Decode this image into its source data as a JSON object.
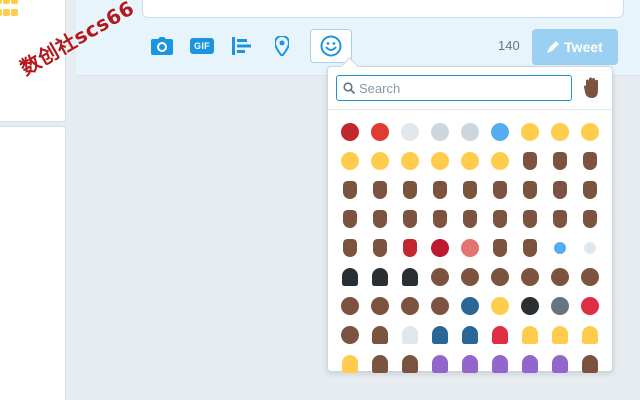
{
  "composer": {
    "char_count": "140",
    "tweet_label": "Tweet",
    "tools": [
      {
        "name": "photo-button",
        "icon": "camera-icon"
      },
      {
        "name": "gif-button",
        "icon": "gif-icon",
        "label": "GIF"
      },
      {
        "name": "poll-button",
        "icon": "poll-icon"
      },
      {
        "name": "location-button",
        "icon": "location-pin-icon"
      },
      {
        "name": "emoji-button",
        "icon": "smiley-icon"
      }
    ]
  },
  "watermark": "数创社scs66",
  "picker": {
    "search_placeholder": "Search",
    "skin_tone_icon": "raised-hand-icon",
    "emojis": [
      {
        "icon": "ogre-icon",
        "color": "#c1272d",
        "type": "face"
      },
      {
        "icon": "goblin-icon",
        "color": "#e03c31",
        "type": "face"
      },
      {
        "icon": "skull-icon",
        "color": "#e1e8ed",
        "type": "face"
      },
      {
        "icon": "ghost-icon",
        "color": "#ccd6dd",
        "type": "face"
      },
      {
        "icon": "alien-icon",
        "color": "#ccd6dd",
        "type": "face"
      },
      {
        "icon": "space-invader-icon",
        "color": "#55acee",
        "type": "face"
      },
      {
        "icon": "cat-smile-icon",
        "color": "#ffcc4d",
        "type": "face"
      },
      {
        "icon": "cat-grin-icon",
        "color": "#ffcc4d",
        "type": "face"
      },
      {
        "icon": "cat-joy-icon",
        "color": "#ffcc4d",
        "type": "face"
      },
      {
        "icon": "cat-heart-eyes-icon",
        "color": "#ffcc4d",
        "type": "face"
      },
      {
        "icon": "cat-smirk-icon",
        "color": "#ffcc4d",
        "type": "face"
      },
      {
        "icon": "cat-kiss-icon",
        "color": "#ffcc4d",
        "type": "face"
      },
      {
        "icon": "cat-scream-icon",
        "color": "#ffcc4d",
        "type": "face"
      },
      {
        "icon": "cat-cry-icon",
        "color": "#ffcc4d",
        "type": "face"
      },
      {
        "icon": "cat-pout-icon",
        "color": "#ffcc4d",
        "type": "face"
      },
      {
        "icon": "raised-hands-icon",
        "color": "#7c533e",
        "type": "hand"
      },
      {
        "icon": "clap-icon",
        "color": "#7c533e",
        "type": "hand"
      },
      {
        "icon": "wave-icon",
        "color": "#7c533e",
        "type": "hand"
      },
      {
        "icon": "thumbs-up-icon",
        "color": "#7c533e",
        "type": "hand"
      },
      {
        "icon": "thumbs-down-icon",
        "color": "#7c533e",
        "type": "hand"
      },
      {
        "icon": "fist-icon",
        "color": "#7c533e",
        "type": "hand"
      },
      {
        "icon": "raised-fist-icon",
        "color": "#7c533e",
        "type": "hand"
      },
      {
        "icon": "victory-icon",
        "color": "#7c533e",
        "type": "hand"
      },
      {
        "icon": "ok-hand-icon",
        "color": "#7c533e",
        "type": "hand"
      },
      {
        "icon": "stop-hand-icon",
        "color": "#7c533e",
        "type": "hand"
      },
      {
        "icon": "open-hands-icon",
        "color": "#7c533e",
        "type": "hand"
      },
      {
        "icon": "flex-icon",
        "color": "#7c533e",
        "type": "hand"
      },
      {
        "icon": "pray-icon",
        "color": "#7c533e",
        "type": "hand"
      },
      {
        "icon": "point-up-icon",
        "color": "#7c533e",
        "type": "hand"
      },
      {
        "icon": "point-up-2-icon",
        "color": "#7c533e",
        "type": "hand"
      },
      {
        "icon": "point-down-icon",
        "color": "#7c533e",
        "type": "hand"
      },
      {
        "icon": "point-left-icon",
        "color": "#7c533e",
        "type": "hand"
      },
      {
        "icon": "point-right-icon",
        "color": "#7c533e",
        "type": "hand"
      },
      {
        "icon": "middle-finger-icon",
        "color": "#7c533e",
        "type": "hand"
      },
      {
        "icon": "splayed-hand-icon",
        "color": "#7c533e",
        "type": "hand"
      },
      {
        "icon": "rock-on-icon",
        "color": "#7c533e",
        "type": "hand"
      },
      {
        "icon": "vulcan-icon",
        "color": "#7c533e",
        "type": "hand"
      },
      {
        "icon": "writing-hand-icon",
        "color": "#7c533e",
        "type": "hand"
      },
      {
        "icon": "nail-polish-icon",
        "color": "#c1272d",
        "type": "hand"
      },
      {
        "icon": "lips-icon",
        "color": "#be1931",
        "type": "face"
      },
      {
        "icon": "tongue-icon",
        "color": "#e2736e",
        "type": "face"
      },
      {
        "icon": "ear-icon",
        "color": "#7c533e",
        "type": "hand"
      },
      {
        "icon": "nose-icon",
        "color": "#7c533e",
        "type": "hand"
      },
      {
        "icon": "eye-icon",
        "color": "#55acee",
        "type": "small"
      },
      {
        "icon": "eyes-icon",
        "color": "#e1e8ed",
        "type": "small"
      },
      {
        "icon": "bust-silhouette-icon",
        "color": "#292f33",
        "type": "person"
      },
      {
        "icon": "busts-silhouette-icon",
        "color": "#292f33",
        "type": "person"
      },
      {
        "icon": "speaking-head-icon",
        "color": "#292f33",
        "type": "person"
      },
      {
        "icon": "baby-icon",
        "color": "#7c533e",
        "type": "face"
      },
      {
        "icon": "boy-icon",
        "color": "#7c533e",
        "type": "face"
      },
      {
        "icon": "girl-icon",
        "color": "#7c533e",
        "type": "face"
      },
      {
        "icon": "man-icon",
        "color": "#7c533e",
        "type": "face"
      },
      {
        "icon": "woman-icon",
        "color": "#7c533e",
        "type": "face"
      },
      {
        "icon": "blond-person-icon",
        "color": "#7c533e",
        "type": "face"
      },
      {
        "icon": "older-man-icon",
        "color": "#7c533e",
        "type": "face"
      },
      {
        "icon": "older-woman-icon",
        "color": "#7c533e",
        "type": "face"
      },
      {
        "icon": "man-gua-pi-mao-icon",
        "color": "#7c533e",
        "type": "face"
      },
      {
        "icon": "man-turban-icon",
        "color": "#7c533e",
        "type": "face"
      },
      {
        "icon": "police-officer-icon",
        "color": "#2a6797",
        "type": "face"
      },
      {
        "icon": "construction-worker-icon",
        "color": "#ffcc4d",
        "type": "face"
      },
      {
        "icon": "guard-icon",
        "color": "#292f33",
        "type": "face"
      },
      {
        "icon": "detective-icon",
        "color": "#66757f",
        "type": "face"
      },
      {
        "icon": "santa-icon",
        "color": "#dd2e44",
        "type": "face"
      },
      {
        "icon": "angel-icon",
        "color": "#7c533e",
        "type": "face"
      },
      {
        "icon": "princess-icon",
        "color": "#7c533e",
        "type": "person"
      },
      {
        "icon": "bride-icon",
        "color": "#e1e8ed",
        "type": "person"
      },
      {
        "icon": "walking-icon",
        "color": "#2a6797",
        "type": "person"
      },
      {
        "icon": "running-icon",
        "color": "#2a6797",
        "type": "person"
      },
      {
        "icon": "dancer-icon",
        "color": "#dd2e44",
        "type": "person"
      },
      {
        "icon": "bunny-dancers-icon",
        "color": "#ffcc4d",
        "type": "person"
      },
      {
        "icon": "couple-icon",
        "color": "#ffcc4d",
        "type": "person"
      },
      {
        "icon": "two-men-icon",
        "color": "#ffcc4d",
        "type": "person"
      },
      {
        "icon": "two-women-icon",
        "color": "#ffcc4d",
        "type": "person"
      },
      {
        "icon": "bowing-icon",
        "color": "#7c533e",
        "type": "person"
      },
      {
        "icon": "info-desk-person-icon",
        "color": "#7c533e",
        "type": "person"
      },
      {
        "icon": "no-gesture-icon",
        "color": "#9266cc",
        "type": "person"
      },
      {
        "icon": "ok-gesture-icon",
        "color": "#9266cc",
        "type": "person"
      },
      {
        "icon": "raising-hand-icon",
        "color": "#9266cc",
        "type": "person"
      },
      {
        "icon": "pouting-person-icon",
        "color": "#9266cc",
        "type": "person"
      },
      {
        "icon": "frowning-person-icon",
        "color": "#9266cc",
        "type": "person"
      },
      {
        "icon": "haircut-icon",
        "color": "#7c533e",
        "type": "person"
      }
    ]
  }
}
